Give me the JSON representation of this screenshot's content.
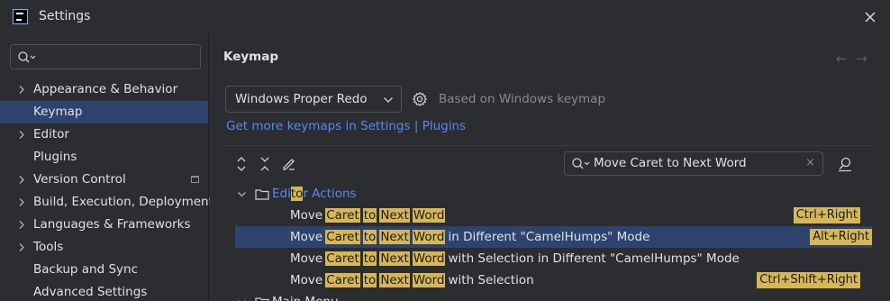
{
  "window": {
    "title": "Settings"
  },
  "sidebar": {
    "search_placeholder": "",
    "items": [
      {
        "label": "Appearance & Behavior",
        "expandable": true
      },
      {
        "label": "Keymap",
        "selected": true
      },
      {
        "label": "Editor",
        "expandable": true
      },
      {
        "label": "Plugins"
      },
      {
        "label": "Version Control",
        "expandable": true,
        "project_icon": true
      },
      {
        "label": "Build, Execution, Deployment",
        "expandable": true
      },
      {
        "label": "Languages & Frameworks",
        "expandable": true
      },
      {
        "label": "Tools",
        "expandable": true
      },
      {
        "label": "Backup and Sync"
      },
      {
        "label": "Advanced Settings"
      }
    ]
  },
  "main": {
    "title": "Keymap",
    "keymap_select": "Windows Proper Redo",
    "based_on": "Based on Windows keymap",
    "link_prefix": "Get more keymaps in Settings",
    "link_sep": "|",
    "link_plugins": "Plugins",
    "action_search": "Move Caret to Next Word",
    "clear_glyph": "×",
    "tree": {
      "group": {
        "pre": "Edi",
        "hl": "to",
        "post": "r Actions"
      },
      "rows": [
        {
          "lead": "Move",
          "w1": "Caret",
          "w2": "to",
          "w3": "Next",
          "w4": "Word",
          "tail": "",
          "shortcut": "Ctrl+Right"
        },
        {
          "lead": "Move",
          "w1": "Caret",
          "w2": "to",
          "w3": "Next",
          "w4": "Word",
          "tail": "in Different \"CamelHumps\" Mode",
          "shortcut": "Alt+Right",
          "selected": true
        },
        {
          "lead": "Move",
          "w1": "Caret",
          "w2": "to",
          "w3": "Next",
          "w4": "Word",
          "tail": "with Selection in Different \"CamelHumps\" Mode",
          "shortcut": ""
        },
        {
          "lead": "Move",
          "w1": "Caret",
          "w2": "to",
          "w3": "Next",
          "w4": "Word",
          "tail": "with Selection",
          "shortcut": "Ctrl+Shift+Right"
        }
      ],
      "next_group": "Main Menu"
    }
  },
  "colors": {
    "accent": "#548af7",
    "highlight": "#d6b656",
    "selection": "#2e436e"
  }
}
